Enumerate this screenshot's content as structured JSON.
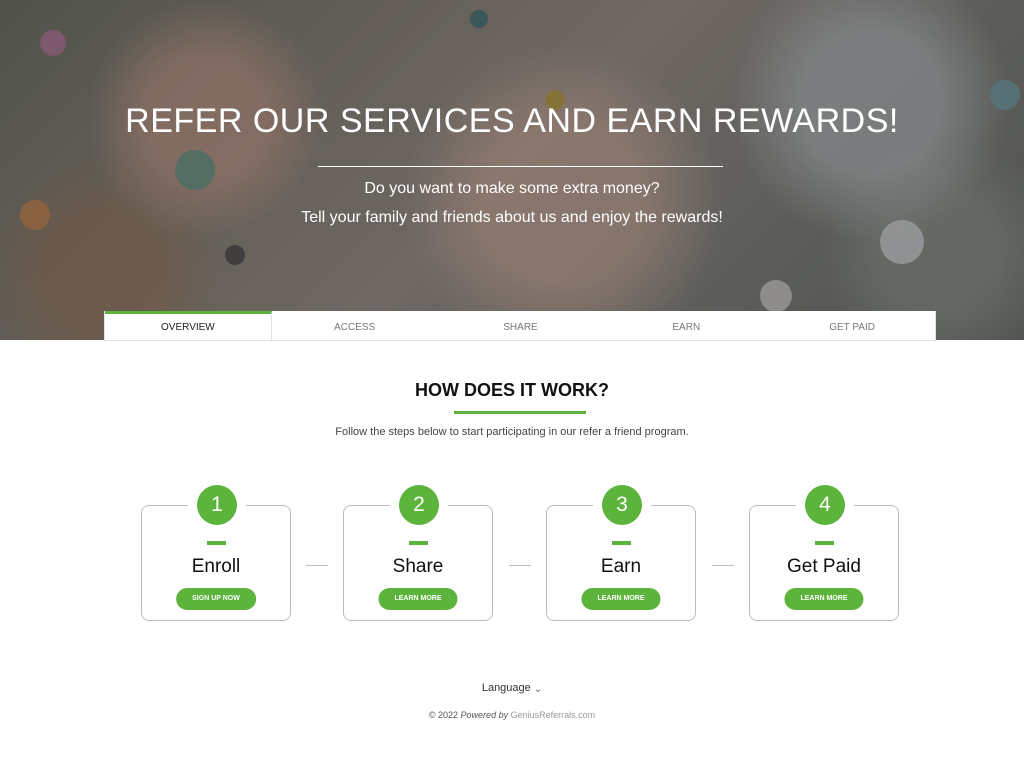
{
  "hero": {
    "title": "REFER OUR SERVICES AND EARN REWARDS!",
    "line1": "Do you want to make some extra money?",
    "line2": "Tell your family and friends about us and enjoy the rewards!"
  },
  "tabs": [
    {
      "label": "OVERVIEW",
      "active": true
    },
    {
      "label": "ACCESS",
      "active": false
    },
    {
      "label": "SHARE",
      "active": false
    },
    {
      "label": "EARN",
      "active": false
    },
    {
      "label": "GET PAID",
      "active": false
    }
  ],
  "how": {
    "title": "HOW DOES IT WORK?",
    "subtitle": "Follow the steps below to start participating in our refer a friend program."
  },
  "steps": [
    {
      "number": "1",
      "title": "Enroll",
      "button": "SIGN UP NOW"
    },
    {
      "number": "2",
      "title": "Share",
      "button": "LEARN MORE"
    },
    {
      "number": "3",
      "title": "Earn",
      "button": "LEARN MORE"
    },
    {
      "number": "4",
      "title": "Get Paid",
      "button": "LEARN MORE"
    }
  ],
  "footer": {
    "language_label": "Language",
    "chevron_icon": "chevron-down-icon",
    "copyright": "© 2022",
    "powered_by": "Powered by",
    "brand": "GeniusReferrals.com"
  },
  "colors": {
    "accent": "#5db43c",
    "card_border": "#bdbdbd",
    "text_dark": "#111111"
  }
}
